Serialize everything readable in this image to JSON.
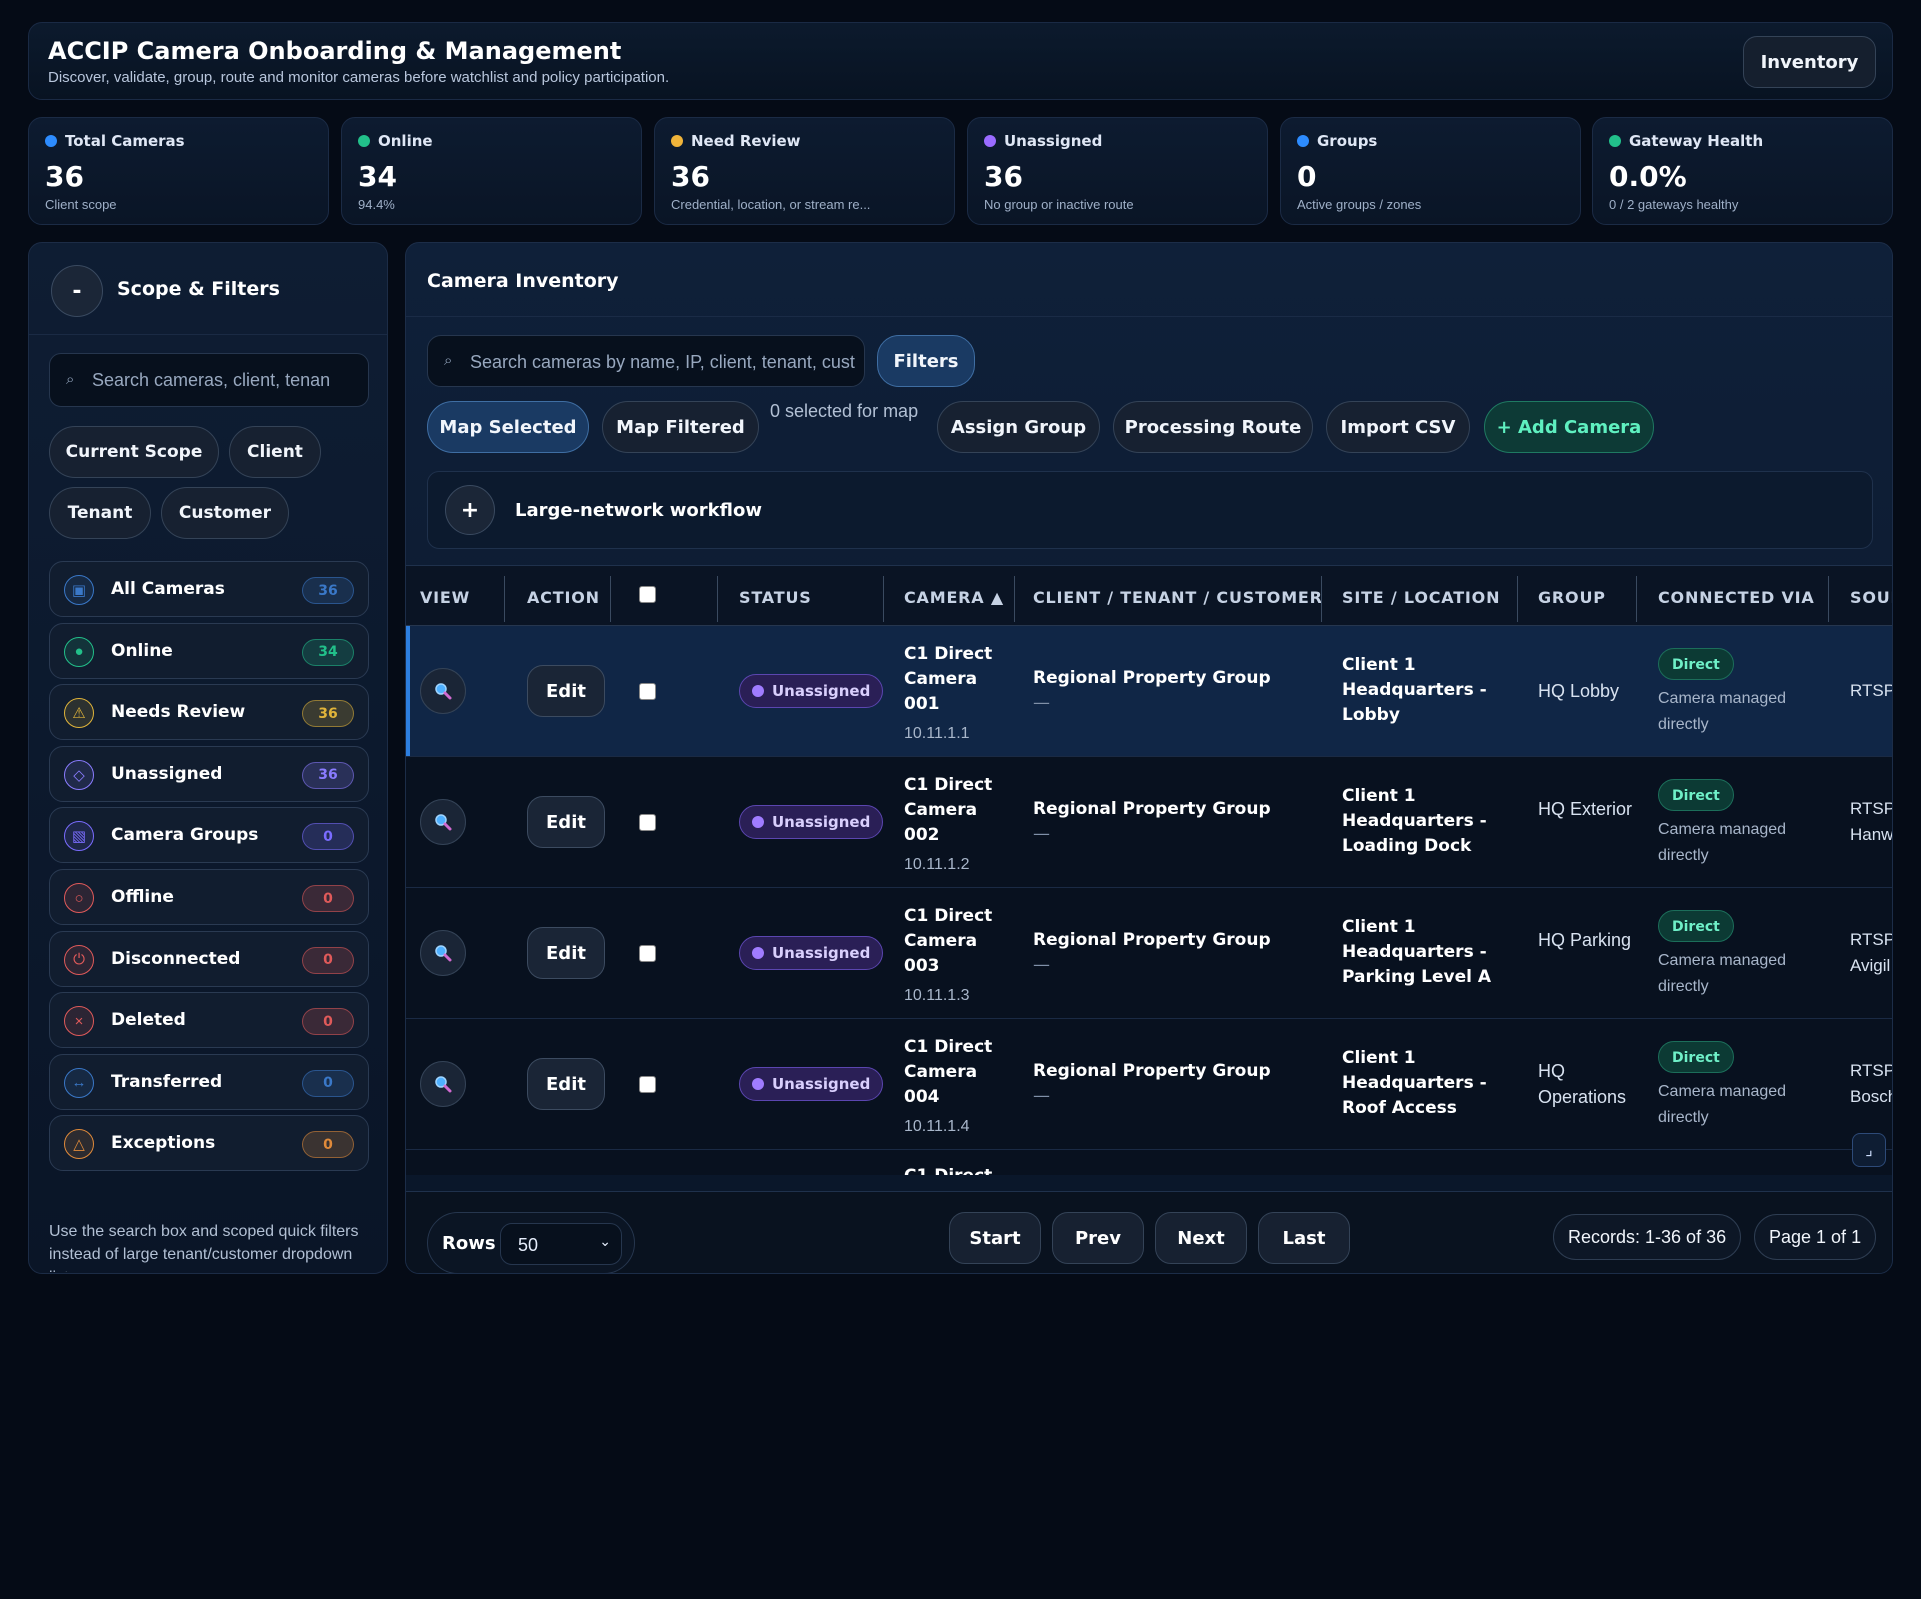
{
  "header": {
    "title": "ACCIP Camera Onboarding & Management",
    "subtitle": "Discover, validate, group, route and monitor cameras before watchlist and policy participation.",
    "inventory_button": "Inventory"
  },
  "stats": [
    {
      "label": "Total Cameras",
      "value": "36",
      "sub": "Client scope",
      "color": "#2d8cff"
    },
    {
      "label": "Online",
      "value": "34",
      "sub": "94.4%",
      "color": "#22c08a"
    },
    {
      "label": "Need Review",
      "value": "36",
      "sub": "Credential, location, or stream re...",
      "color": "#f0b43a"
    },
    {
      "label": "Unassigned",
      "value": "36",
      "sub": "No group or inactive route",
      "color": "#9a6bff"
    },
    {
      "label": "Groups",
      "value": "0",
      "sub": "Active groups / zones",
      "color": "#2d8cff"
    },
    {
      "label": "Gateway Health",
      "value": "0.0%",
      "sub": "0 / 2 gateways healthy",
      "color": "#22c08a"
    }
  ],
  "sidebar": {
    "collapse_label": "-",
    "title": "Scope & Filters",
    "search_placeholder": "Search cameras, client, tenan",
    "scope_chips": [
      "Current Scope",
      "Client",
      "Tenant",
      "Customer"
    ],
    "quick_filters": [
      {
        "label": "All Cameras",
        "count": "36",
        "icon": "list-icon",
        "glyph": "▣",
        "color": "#3a78c8"
      },
      {
        "label": "Online",
        "count": "34",
        "icon": "online-dot-icon",
        "glyph": "●",
        "color": "#22c08a"
      },
      {
        "label": "Needs Review",
        "count": "36",
        "icon": "warning-icon",
        "glyph": "⚠",
        "color": "#e0b43a"
      },
      {
        "label": "Unassigned",
        "count": "36",
        "icon": "diamond-icon",
        "glyph": "◇",
        "color": "#8a7cff"
      },
      {
        "label": "Camera Groups",
        "count": "0",
        "icon": "groups-icon",
        "glyph": "▧",
        "color": "#7a6cff"
      },
      {
        "label": "Offline",
        "count": "0",
        "icon": "offline-icon",
        "glyph": "○",
        "color": "#e05a5a"
      },
      {
        "label": "Disconnected",
        "count": "0",
        "icon": "power-icon",
        "glyph": "⏻",
        "color": "#e05a5a"
      },
      {
        "label": "Deleted",
        "count": "0",
        "icon": "close-icon",
        "glyph": "×",
        "color": "#e05a5a"
      },
      {
        "label": "Transferred",
        "count": "0",
        "icon": "transfer-icon",
        "glyph": "↔",
        "color": "#3a78c8"
      },
      {
        "label": "Exceptions",
        "count": "0",
        "icon": "triangle-icon",
        "glyph": "△",
        "color": "#e08a3a"
      }
    ],
    "note": "Use the search box and scoped quick filters instead of large tenant/customer dropdown lists."
  },
  "main": {
    "title": "Camera Inventory",
    "search_placeholder": "Search cameras by name, IP, client, tenant, customer",
    "filters_button": "Filters",
    "map_selected": "Map Selected",
    "map_filtered": "Map Filtered",
    "selected_for_map": "0 selected for map",
    "assign_group": "Assign Group",
    "processing_route": "Processing Route",
    "import_csv": "Import CSV",
    "add_camera": "+ Add Camera",
    "workflow_toggle": "+",
    "workflow_label": "Large-network workflow"
  },
  "table": {
    "columns": [
      "VIEW",
      "ACTION",
      "STATUS",
      "CAMERA ▲",
      "CLIENT / TENANT / CUSTOMER",
      "SITE / LOCATION",
      "GROUP",
      "CONNECTED VIA",
      "SOUR"
    ],
    "rows": [
      {
        "edit": "Edit",
        "status": "Unassigned",
        "camera": "C1 Direct Camera 001",
        "ip": "10.11.1.1",
        "client": "Regional Property Group",
        "client_sub": "—",
        "site": "Client 1 Headquarters - Lobby",
        "group": "HQ Lobby",
        "conn": "Direct",
        "conn_sub": "Camera managed directly",
        "source": "RTSP",
        "source2": ""
      },
      {
        "edit": "Edit",
        "status": "Unassigned",
        "camera": "C1 Direct Camera 002",
        "ip": "10.11.1.2",
        "client": "Regional Property Group",
        "client_sub": "—",
        "site": "Client 1 Headquarters - Loading Dock",
        "group": "HQ Exterior",
        "conn": "Direct",
        "conn_sub": "Camera managed directly",
        "source": "RTSP",
        "source2": "Hanw"
      },
      {
        "edit": "Edit",
        "status": "Unassigned",
        "camera": "C1 Direct Camera 003",
        "ip": "10.11.1.3",
        "client": "Regional Property Group",
        "client_sub": "—",
        "site": "Client 1 Headquarters - Parking Level A",
        "group": "HQ Parking",
        "conn": "Direct",
        "conn_sub": "Camera managed directly",
        "source": "RTSP",
        "source2": "Avigil"
      },
      {
        "edit": "Edit",
        "status": "Unassigned",
        "camera": "C1 Direct Camera 004",
        "ip": "10.11.1.4",
        "client": "Regional Property Group",
        "client_sub": "—",
        "site": "Client 1 Headquarters - Roof Access",
        "group": "HQ Operations",
        "conn": "Direct",
        "conn_sub": "Camera managed directly",
        "source": "RTSP",
        "source2": "Bosch"
      }
    ],
    "partial_row_camera": "C1 Direct"
  },
  "footer": {
    "rows_label": "Rows",
    "rows_value": "50",
    "start": "Start",
    "prev": "Prev",
    "next": "Next",
    "last": "Last",
    "records": "Records: 1-36 of 36",
    "page": "Page 1 of 1"
  }
}
